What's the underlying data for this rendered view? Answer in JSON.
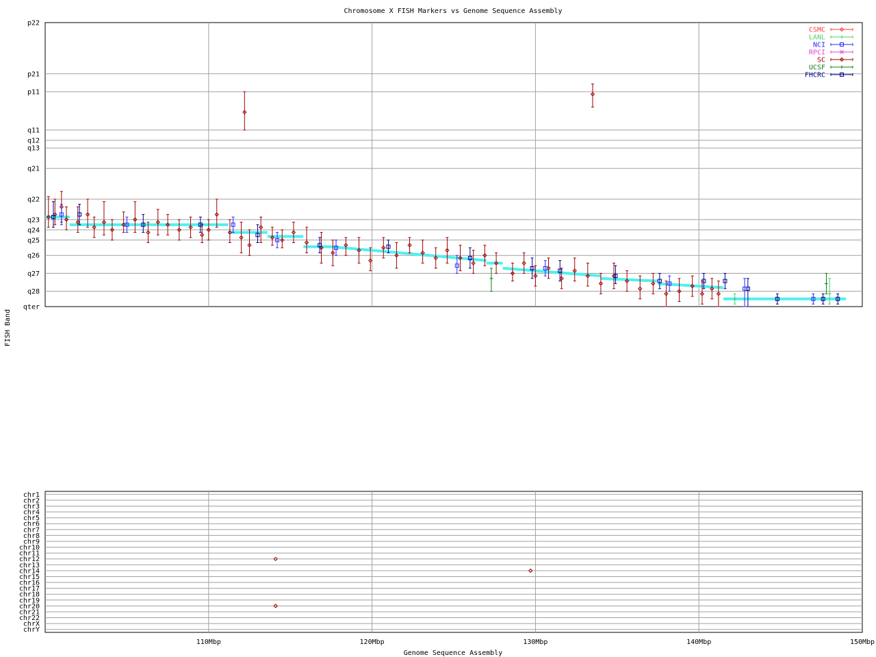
{
  "chart_data": {
    "type": "scatter",
    "title": "Chromosome X FISH Markers vs Genome Sequence Assembly",
    "xlabel": "Genome Sequence Assembly",
    "ylabel": "FISH Band",
    "xlim": [
      100,
      150
    ],
    "x_unit": "Mbp",
    "x_ticks": [
      {
        "v": 110,
        "label": "110Mbp"
      },
      {
        "v": 120,
        "label": "120Mbp"
      },
      {
        "v": 130,
        "label": "130Mbp"
      },
      {
        "v": 140,
        "label": "140Mbp"
      },
      {
        "v": 150,
        "label": "150Mbp"
      }
    ],
    "grid": true,
    "legend_position": "top-right",
    "legend": [
      {
        "name": "CSMC",
        "color": "#ff3b3b",
        "marker": "diamond"
      },
      {
        "name": "LANL",
        "color": "#4ccf6a",
        "marker": "plus"
      },
      {
        "name": "NCI",
        "color": "#2a2aff",
        "marker": "square"
      },
      {
        "name": "RPCI",
        "color": "#e040e0",
        "marker": "cross"
      },
      {
        "name": "SC",
        "color": "#a00000",
        "marker": "diamond"
      },
      {
        "name": "UCSF",
        "color": "#108010",
        "marker": "plus"
      },
      {
        "name": "FHCRC",
        "color": "#00008b",
        "marker": "square"
      }
    ],
    "band_axis": {
      "labels": [
        "p22",
        "p21",
        "p11",
        "q11",
        "q12",
        "q13",
        "q21",
        "q22",
        "q23",
        "q24",
        "q25",
        "q26",
        "q27",
        "q28",
        "qter"
      ],
      "values": [
        0,
        1.0,
        1.35,
        2.1,
        2.3,
        2.45,
        2.85,
        3.45,
        3.85,
        4.05,
        4.25,
        4.55,
        4.9,
        5.25,
        5.55
      ],
      "range": [
        0,
        5.55
      ]
    },
    "chromosome_axis": {
      "labels": [
        "chr1",
        "chr2",
        "chr3",
        "chr4",
        "chr5",
        "chr6",
        "chr7",
        "chr8",
        "chr9",
        "chr10",
        "chr11",
        "chr12",
        "chr13",
        "chr14",
        "chr15",
        "chr16",
        "chr17",
        "chr18",
        "chr19",
        "chr20",
        "chr21",
        "chr22",
        "chrX",
        "chrY"
      ]
    },
    "consensus_line": {
      "color": "#4ff0f0",
      "segments": [
        {
          "x": [
            100.0,
            101.5
          ],
          "y": [
            3.8,
            3.8
          ]
        },
        {
          "x": [
            101.5,
            111.2
          ],
          "y": [
            3.95,
            3.95
          ]
        },
        {
          "x": [
            111.2,
            113.6
          ],
          "y": [
            4.1,
            4.1
          ]
        },
        {
          "x": [
            113.6,
            115.8
          ],
          "y": [
            4.18,
            4.18
          ]
        },
        {
          "x": [
            115.8,
            117.5
          ],
          "y": [
            4.38,
            4.38
          ]
        },
        {
          "x": [
            117.5,
            127.0
          ],
          "y": [
            4.38,
            4.65
          ]
        },
        {
          "x": [
            127.0,
            128.0
          ],
          "y": [
            4.7,
            4.7
          ]
        },
        {
          "x": [
            128.0,
            134.0
          ],
          "y": [
            4.8,
            4.95
          ]
        },
        {
          "x": [
            134.0,
            137.5
          ],
          "y": [
            5.0,
            5.05
          ]
        },
        {
          "x": [
            137.5,
            141.5
          ],
          "y": [
            5.1,
            5.18
          ]
        },
        {
          "x": [
            141.5,
            149.0
          ],
          "y": [
            5.4,
            5.4
          ]
        }
      ]
    },
    "band_series": [
      {
        "source": "SC",
        "points": [
          [
            100.2,
            3.8,
            3.4,
            4.0
          ],
          [
            100.6,
            3.75,
            3.45,
            3.95
          ],
          [
            101.0,
            3.6,
            3.3,
            3.9
          ],
          [
            101.3,
            3.85,
            3.6,
            4.05
          ],
          [
            102.0,
            3.9,
            3.6,
            4.1
          ],
          [
            102.6,
            3.75,
            3.45,
            4.0
          ],
          [
            103.0,
            4.0,
            3.8,
            4.2
          ],
          [
            103.6,
            3.9,
            3.5,
            4.15
          ],
          [
            104.1,
            4.05,
            3.85,
            4.25
          ],
          [
            104.8,
            3.95,
            3.7,
            4.1
          ],
          [
            105.5,
            3.85,
            3.5,
            4.1
          ],
          [
            106.3,
            4.1,
            3.9,
            4.3
          ],
          [
            106.9,
            3.9,
            3.65,
            4.15
          ],
          [
            107.5,
            3.95,
            3.75,
            4.15
          ],
          [
            108.2,
            4.05,
            3.85,
            4.25
          ],
          [
            108.9,
            4.0,
            3.8,
            4.2
          ],
          [
            109.6,
            4.15,
            3.95,
            4.3
          ],
          [
            110.0,
            4.05,
            3.85,
            4.25
          ],
          [
            110.5,
            3.75,
            3.45,
            4.0
          ],
          [
            111.3,
            4.1,
            3.85,
            4.3
          ],
          [
            112.0,
            4.2,
            3.9,
            4.5
          ],
          [
            112.5,
            4.35,
            4.05,
            4.55
          ],
          [
            113.2,
            4.0,
            3.8,
            4.3
          ],
          [
            113.9,
            4.2,
            4.0,
            4.35
          ],
          [
            114.5,
            4.25,
            4.05,
            4.4
          ],
          [
            115.2,
            4.1,
            3.9,
            4.3
          ],
          [
            116.0,
            4.3,
            4.0,
            4.5
          ],
          [
            116.9,
            4.4,
            4.1,
            4.7
          ],
          [
            117.6,
            4.5,
            4.25,
            4.75
          ],
          [
            118.4,
            4.35,
            4.2,
            4.55
          ],
          [
            119.2,
            4.45,
            4.2,
            4.7
          ],
          [
            119.9,
            4.65,
            4.4,
            4.85
          ],
          [
            120.7,
            4.4,
            4.2,
            4.6
          ],
          [
            121.5,
            4.55,
            4.3,
            4.8
          ],
          [
            122.3,
            4.35,
            4.2,
            4.5
          ],
          [
            123.1,
            4.5,
            4.25,
            4.7
          ],
          [
            123.9,
            4.6,
            4.4,
            4.8
          ],
          [
            124.6,
            4.45,
            4.2,
            4.7
          ],
          [
            125.4,
            4.6,
            4.35,
            4.85
          ],
          [
            126.2,
            4.7,
            4.45,
            4.9
          ],
          [
            126.9,
            4.55,
            4.35,
            4.75
          ],
          [
            127.6,
            4.7,
            4.5,
            4.9
          ],
          [
            128.6,
            4.9,
            4.7,
            5.05
          ],
          [
            129.3,
            4.7,
            4.5,
            4.9
          ],
          [
            130.0,
            4.95,
            4.75,
            5.15
          ],
          [
            130.8,
            4.8,
            4.6,
            5.0
          ],
          [
            131.6,
            5.0,
            4.8,
            5.2
          ],
          [
            132.4,
            4.85,
            4.6,
            5.05
          ],
          [
            133.2,
            4.95,
            4.7,
            5.15
          ],
          [
            134.0,
            5.1,
            4.9,
            5.3
          ],
          [
            134.8,
            4.95,
            4.7,
            5.2
          ],
          [
            135.6,
            5.05,
            4.85,
            5.25
          ],
          [
            136.4,
            5.2,
            4.95,
            5.4
          ],
          [
            137.2,
            5.1,
            4.9,
            5.3
          ],
          [
            138.0,
            5.3,
            5.05,
            5.55
          ],
          [
            138.8,
            5.25,
            5.0,
            5.45
          ],
          [
            139.6,
            5.15,
            4.95,
            5.35
          ],
          [
            140.2,
            5.3,
            5.05,
            5.5
          ],
          [
            140.8,
            5.2,
            5.0,
            5.4
          ],
          [
            141.2,
            5.3,
            5.05,
            5.55
          ],
          [
            112.2,
            1.75,
            1.35,
            2.1
          ],
          [
            133.5,
            1.4,
            1.2,
            1.65
          ]
        ]
      },
      {
        "source": "FHCRC",
        "points": [
          [
            100.5,
            3.8,
            3.5,
            4.0
          ],
          [
            102.1,
            3.75,
            3.55,
            3.95
          ],
          [
            106.0,
            3.95,
            3.75,
            4.1
          ],
          [
            109.5,
            3.95,
            3.8,
            4.1
          ],
          [
            113.0,
            4.15,
            3.95,
            4.3
          ],
          [
            116.8,
            4.35,
            4.2,
            4.5
          ],
          [
            121.0,
            4.38,
            4.25,
            4.5
          ],
          [
            126.0,
            4.6,
            4.4,
            4.8
          ],
          [
            129.8,
            4.8,
            4.6,
            5.0
          ],
          [
            131.5,
            4.85,
            4.65,
            5.05
          ],
          [
            134.9,
            4.95,
            4.75,
            5.1
          ],
          [
            137.6,
            5.05,
            4.9,
            5.2
          ],
          [
            140.3,
            5.05,
            4.9,
            5.2
          ],
          [
            141.6,
            5.05,
            4.9,
            5.2
          ],
          [
            143.0,
            5.2,
            5.0,
            5.55
          ],
          [
            144.8,
            5.4,
            5.3,
            5.5
          ],
          [
            147.6,
            5.4,
            5.3,
            5.5
          ],
          [
            148.5,
            5.4,
            5.3,
            5.5
          ]
        ]
      },
      {
        "source": "NCI",
        "points": [
          [
            101.0,
            3.75,
            3.55,
            3.95
          ],
          [
            105.0,
            3.95,
            3.8,
            4.1
          ],
          [
            111.5,
            3.95,
            3.8,
            4.1
          ],
          [
            114.2,
            4.25,
            4.1,
            4.4
          ],
          [
            117.8,
            4.4,
            4.25,
            4.55
          ],
          [
            125.2,
            4.75,
            4.55,
            4.9
          ],
          [
            130.6,
            4.8,
            4.65,
            4.95
          ],
          [
            138.2,
            5.1,
            4.95,
            5.25
          ],
          [
            142.8,
            5.2,
            5.0,
            5.55
          ],
          [
            147.0,
            5.4,
            5.3,
            5.5
          ]
        ]
      },
      {
        "source": "UCSF",
        "points": [
          [
            127.3,
            5.0,
            4.8,
            5.25
          ],
          [
            147.8,
            5.1,
            4.9,
            5.3
          ]
        ]
      },
      {
        "source": "LANL",
        "points": [
          [
            142.2,
            5.4,
            5.3,
            5.5
          ],
          [
            148.0,
            5.3,
            5.0,
            5.5
          ]
        ]
      }
    ],
    "chromosome_points": [
      {
        "source": "SC",
        "x": 114.1,
        "chrom": "chr12"
      },
      {
        "source": "SC",
        "x": 114.1,
        "chrom": "chr20"
      },
      {
        "source": "SC",
        "x": 129.7,
        "chrom": "chr14"
      }
    ]
  }
}
